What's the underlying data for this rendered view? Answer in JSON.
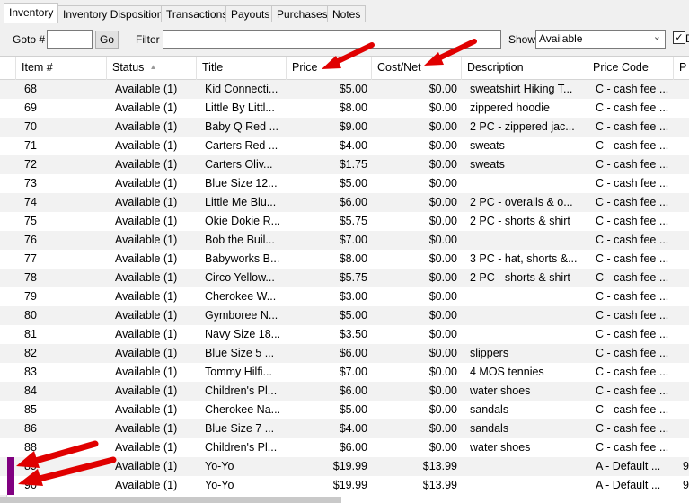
{
  "tabs": [
    {
      "label": "Inventory",
      "active": true
    },
    {
      "label": "Inventory Disposition",
      "active": false
    },
    {
      "label": "Transactions",
      "active": false
    },
    {
      "label": "Payouts",
      "active": false
    },
    {
      "label": "Purchases",
      "active": false
    },
    {
      "label": "Notes",
      "active": false
    }
  ],
  "toolbar": {
    "goto_label": "Goto #",
    "goto_value": "",
    "go_label": "Go",
    "filter_label": "Filter",
    "filter_value": "",
    "show_label": "Show",
    "show_value": "Available",
    "checkbox_checked": true,
    "checkbox_label": "D"
  },
  "columns": [
    "Item #",
    "Status",
    "Title",
    "Price",
    "Cost/Net",
    "Description",
    "Price Code",
    "P"
  ],
  "sorted_column": "Status",
  "colors": {
    "stripe": "#f2f2f2",
    "indicator": "#800080",
    "annotation_arrow": "#e00000"
  },
  "rows": [
    {
      "item": "68",
      "status": "Available (1)",
      "title": "Kid Connecti...",
      "price": "$5.00",
      "cost": "$0.00",
      "description": "sweatshirt Hiking T...",
      "price_code": "C - cash fee ...",
      "p": "",
      "flag": false
    },
    {
      "item": "69",
      "status": "Available (1)",
      "title": "Little By Littl...",
      "price": "$8.00",
      "cost": "$0.00",
      "description": "zippered hoodie",
      "price_code": "C - cash fee ...",
      "p": "",
      "flag": false
    },
    {
      "item": "70",
      "status": "Available (1)",
      "title": "Baby Q Red ...",
      "price": "$9.00",
      "cost": "$0.00",
      "description": "2 PC - zippered jac...",
      "price_code": "C - cash fee ...",
      "p": "",
      "flag": false
    },
    {
      "item": "71",
      "status": "Available (1)",
      "title": "Carters Red ...",
      "price": "$4.00",
      "cost": "$0.00",
      "description": "sweats",
      "price_code": "C - cash fee ...",
      "p": "",
      "flag": false
    },
    {
      "item": "72",
      "status": "Available (1)",
      "title": "Carters Oliv...",
      "price": "$1.75",
      "cost": "$0.00",
      "description": "sweats",
      "price_code": "C - cash fee ...",
      "p": "",
      "flag": false
    },
    {
      "item": "73",
      "status": "Available (1)",
      "title": "Blue Size 12...",
      "price": "$5.00",
      "cost": "$0.00",
      "description": "",
      "price_code": "C - cash fee ...",
      "p": "",
      "flag": false
    },
    {
      "item": "74",
      "status": "Available (1)",
      "title": "Little Me Blu...",
      "price": "$6.00",
      "cost": "$0.00",
      "description": "2 PC - overalls & o...",
      "price_code": "C - cash fee ...",
      "p": "",
      "flag": false
    },
    {
      "item": "75",
      "status": "Available (1)",
      "title": "Okie Dokie R...",
      "price": "$5.75",
      "cost": "$0.00",
      "description": "2 PC - shorts & shirt",
      "price_code": "C - cash fee ...",
      "p": "",
      "flag": false
    },
    {
      "item": "76",
      "status": "Available (1)",
      "title": "Bob the Buil...",
      "price": "$7.00",
      "cost": "$0.00",
      "description": "",
      "price_code": "C - cash fee ...",
      "p": "",
      "flag": false
    },
    {
      "item": "77",
      "status": "Available (1)",
      "title": "Babyworks B...",
      "price": "$8.00",
      "cost": "$0.00",
      "description": "3 PC - hat, shorts &...",
      "price_code": "C - cash fee ...",
      "p": "",
      "flag": false
    },
    {
      "item": "78",
      "status": "Available (1)",
      "title": "Circo Yellow...",
      "price": "$5.75",
      "cost": "$0.00",
      "description": "2 PC - shorts & shirt",
      "price_code": "C - cash fee ...",
      "p": "",
      "flag": false
    },
    {
      "item": "79",
      "status": "Available (1)",
      "title": "Cherokee W...",
      "price": "$3.00",
      "cost": "$0.00",
      "description": "",
      "price_code": "C - cash fee ...",
      "p": "",
      "flag": false
    },
    {
      "item": "80",
      "status": "Available (1)",
      "title": "Gymboree N...",
      "price": "$5.00",
      "cost": "$0.00",
      "description": "",
      "price_code": "C - cash fee ...",
      "p": "",
      "flag": false
    },
    {
      "item": "81",
      "status": "Available (1)",
      "title": "Navy Size 18...",
      "price": "$3.50",
      "cost": "$0.00",
      "description": "",
      "price_code": "C - cash fee ...",
      "p": "",
      "flag": false
    },
    {
      "item": "82",
      "status": "Available (1)",
      "title": "Blue Size 5 ...",
      "price": "$6.00",
      "cost": "$0.00",
      "description": "slippers",
      "price_code": "C - cash fee ...",
      "p": "",
      "flag": false
    },
    {
      "item": "83",
      "status": "Available (1)",
      "title": "Tommy Hilfi...",
      "price": "$7.00",
      "cost": "$0.00",
      "description": "4 MOS tennies",
      "price_code": "C - cash fee ...",
      "p": "",
      "flag": false
    },
    {
      "item": "84",
      "status": "Available (1)",
      "title": "Children's Pl...",
      "price": "$6.00",
      "cost": "$0.00",
      "description": "water shoes",
      "price_code": "C - cash fee ...",
      "p": "",
      "flag": false
    },
    {
      "item": "85",
      "status": "Available (1)",
      "title": "Cherokee Na...",
      "price": "$5.00",
      "cost": "$0.00",
      "description": "sandals",
      "price_code": "C - cash fee ...",
      "p": "",
      "flag": false
    },
    {
      "item": "86",
      "status": "Available (1)",
      "title": "Blue Size 7 ...",
      "price": "$4.00",
      "cost": "$0.00",
      "description": "sandals",
      "price_code": "C - cash fee ...",
      "p": "",
      "flag": false
    },
    {
      "item": "88",
      "status": "Available (1)",
      "title": "Children's Pl...",
      "price": "$6.00",
      "cost": "$0.00",
      "description": "water shoes",
      "price_code": "C - cash fee ...",
      "p": "",
      "flag": false
    },
    {
      "item": "89",
      "status": "Available (1)",
      "title": "Yo-Yo",
      "price": "$19.99",
      "cost": "$13.99",
      "description": "",
      "price_code": "A - Default ...",
      "p": "9",
      "flag": true
    },
    {
      "item": "90",
      "status": "Available (1)",
      "title": "Yo-Yo",
      "price": "$19.99",
      "cost": "$13.99",
      "description": "",
      "price_code": "A - Default ...",
      "p": "9",
      "flag": true
    }
  ]
}
